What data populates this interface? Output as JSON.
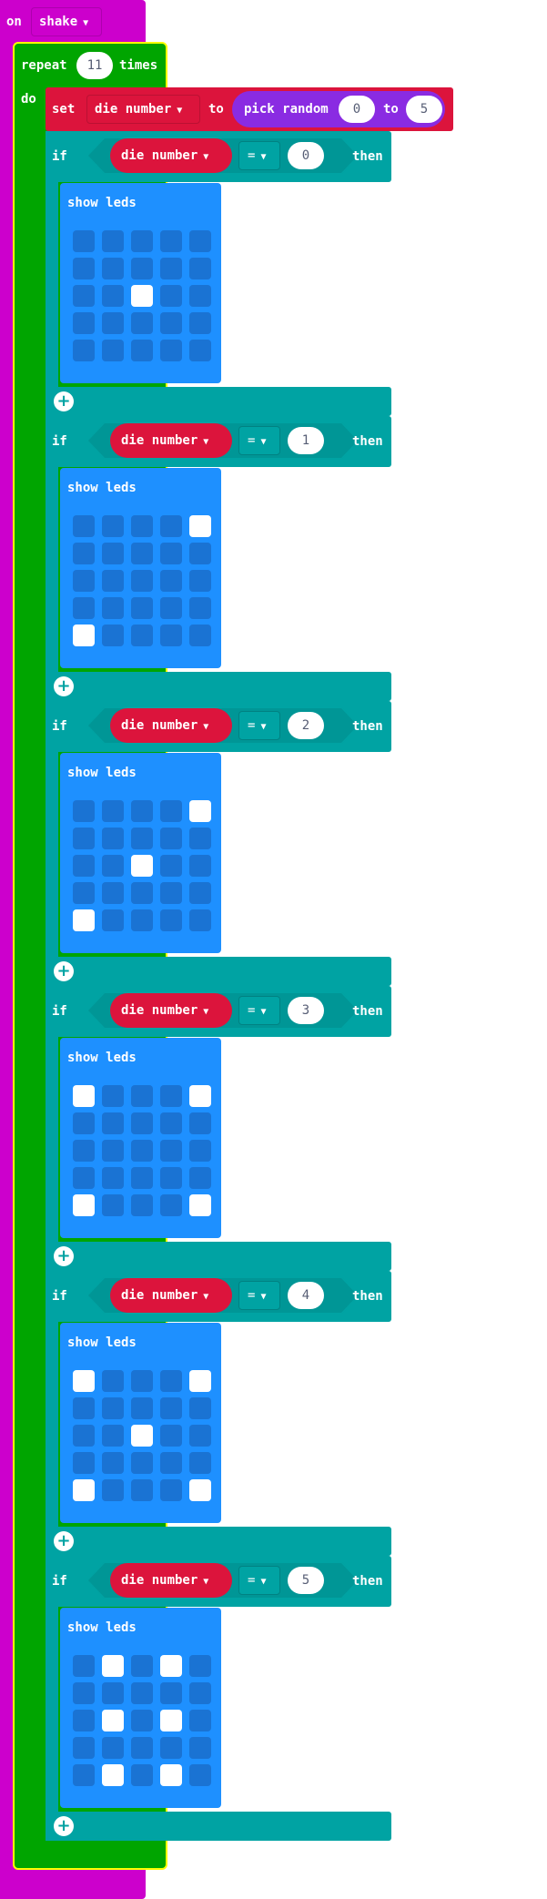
{
  "event": {
    "on_label": "on",
    "gesture": "shake"
  },
  "loop": {
    "repeat_label": "repeat",
    "count": "11",
    "times_label": "times",
    "do_label": "do"
  },
  "set_block": {
    "set_label": "set",
    "variable": "die number",
    "to_label": "to",
    "random_label": "pick random",
    "min": "0",
    "to2_label": "to",
    "max": "5"
  },
  "if_labels": {
    "if": "if",
    "then": "then",
    "show_leds": "show leds"
  },
  "conditions": [
    {
      "variable": "die number",
      "operator": "=",
      "value": "0",
      "leds": [
        [
          0,
          0,
          0,
          0,
          0
        ],
        [
          0,
          0,
          0,
          0,
          0
        ],
        [
          0,
          0,
          1,
          0,
          0
        ],
        [
          0,
          0,
          0,
          0,
          0
        ],
        [
          0,
          0,
          0,
          0,
          0
        ]
      ]
    },
    {
      "variable": "die number",
      "operator": "=",
      "value": "1",
      "leds": [
        [
          0,
          0,
          0,
          0,
          1
        ],
        [
          0,
          0,
          0,
          0,
          0
        ],
        [
          0,
          0,
          0,
          0,
          0
        ],
        [
          0,
          0,
          0,
          0,
          0
        ],
        [
          1,
          0,
          0,
          0,
          0
        ]
      ]
    },
    {
      "variable": "die number",
      "operator": "=",
      "value": "2",
      "leds": [
        [
          0,
          0,
          0,
          0,
          1
        ],
        [
          0,
          0,
          0,
          0,
          0
        ],
        [
          0,
          0,
          1,
          0,
          0
        ],
        [
          0,
          0,
          0,
          0,
          0
        ],
        [
          1,
          0,
          0,
          0,
          0
        ]
      ]
    },
    {
      "variable": "die number",
      "operator": "=",
      "value": "3",
      "leds": [
        [
          1,
          0,
          0,
          0,
          1
        ],
        [
          0,
          0,
          0,
          0,
          0
        ],
        [
          0,
          0,
          0,
          0,
          0
        ],
        [
          0,
          0,
          0,
          0,
          0
        ],
        [
          1,
          0,
          0,
          0,
          1
        ]
      ]
    },
    {
      "variable": "die number",
      "operator": "=",
      "value": "4",
      "leds": [
        [
          1,
          0,
          0,
          0,
          1
        ],
        [
          0,
          0,
          0,
          0,
          0
        ],
        [
          0,
          0,
          1,
          0,
          0
        ],
        [
          0,
          0,
          0,
          0,
          0
        ],
        [
          1,
          0,
          0,
          0,
          1
        ]
      ]
    },
    {
      "variable": "die number",
      "operator": "=",
      "value": "5",
      "leds": [
        [
          0,
          1,
          0,
          1,
          0
        ],
        [
          0,
          0,
          0,
          0,
          0
        ],
        [
          0,
          1,
          0,
          1,
          0
        ],
        [
          0,
          0,
          0,
          0,
          0
        ],
        [
          0,
          1,
          0,
          1,
          0
        ]
      ]
    }
  ],
  "colors": {
    "event": "#cc00cc",
    "loop": "#00a500",
    "variable": "#dc143c",
    "logic": "#00a3a3",
    "math_random": "#8a2be2",
    "basic": "#1e90ff",
    "led_off": "#1a73d3",
    "led_on": "#ffffff",
    "highlight": "#ffff00"
  },
  "icons": {
    "dropdown": "chevron-down-icon",
    "add": "plus-circle-icon"
  }
}
